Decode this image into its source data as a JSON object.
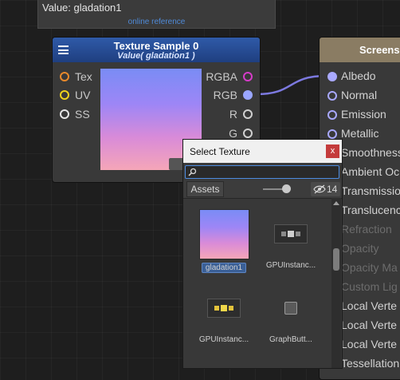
{
  "tooltip": {
    "value_text": "Value: gladation1",
    "link_text": "online reference"
  },
  "texture_node": {
    "title": "Texture Sample 0",
    "subtitle": "Value( gladation1 )",
    "inputs": [
      {
        "label": "Tex",
        "color": "#e8892b"
      },
      {
        "label": "UV",
        "color": "#f0d21c"
      },
      {
        "label": "SS",
        "color": "#e6e6e6"
      }
    ],
    "outputs": [
      {
        "label": "RGBA",
        "color": "#d63cc9"
      },
      {
        "label": "RGB",
        "color": "#9aa6ff"
      },
      {
        "label": "R",
        "color": "#d0d0d0"
      },
      {
        "label": "G",
        "color": "#d0d0d0"
      }
    ]
  },
  "screenspace_node": {
    "title": "Screensp",
    "items": [
      {
        "label": "Albedo",
        "enabled": true
      },
      {
        "label": "Normal",
        "enabled": true
      },
      {
        "label": "Emission",
        "enabled": true
      },
      {
        "label": "Metallic",
        "enabled": true
      },
      {
        "label": "Smoothness",
        "enabled": true
      },
      {
        "label": "Ambient Oc",
        "enabled": true
      },
      {
        "label": "Transmissio",
        "enabled": true
      },
      {
        "label": "Translucenc",
        "enabled": true
      },
      {
        "label": "Refraction",
        "enabled": false
      },
      {
        "label": "Opacity",
        "enabled": false
      },
      {
        "label": "Opacity Ma",
        "enabled": false
      },
      {
        "label": "Custom Lig",
        "enabled": false
      },
      {
        "label": "Local Verte",
        "enabled": true
      },
      {
        "label": "Local Verte",
        "enabled": true
      },
      {
        "label": "Local Verte",
        "enabled": true
      },
      {
        "label": "Tessellation",
        "enabled": true
      }
    ]
  },
  "popup": {
    "title": "Select Texture",
    "close_label": "x",
    "search_value": "",
    "tab_label": "Assets",
    "hidden_count": "14",
    "assets": [
      {
        "label": "gladation1",
        "selected": true,
        "icon": "gradient-texture-icon"
      },
      {
        "label": "GPUInstanc...",
        "selected": false,
        "icon": "gpu-instancing-icon"
      },
      {
        "label": "GPUInstanc...",
        "selected": false,
        "icon": "gpu-instancing-icon"
      },
      {
        "label": "GraphButt...",
        "selected": false,
        "icon": "graph-button-icon"
      }
    ]
  },
  "colors": {
    "accent": "#2f5aa8",
    "wire": "#9aa6ff",
    "selection": "#3a5f96"
  }
}
